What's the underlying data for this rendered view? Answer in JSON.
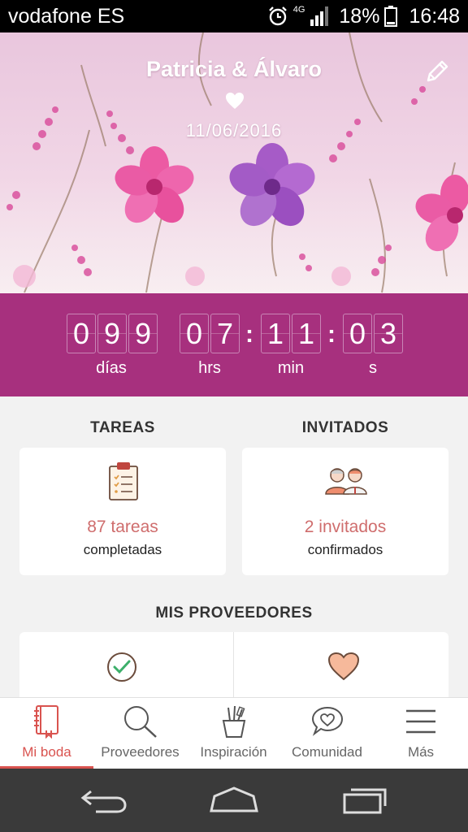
{
  "status_bar": {
    "carrier": "vodafone ES",
    "network": "4G",
    "battery": "18%",
    "time": "16:48"
  },
  "header": {
    "couple_names": "Patricia & Álvaro",
    "date": "11/06/2016"
  },
  "countdown": {
    "days": [
      "0",
      "9",
      "9"
    ],
    "hours": [
      "0",
      "7"
    ],
    "minutes": [
      "1",
      "1"
    ],
    "seconds": [
      "0",
      "3"
    ],
    "labels": {
      "days": "días",
      "hours": "hrs",
      "minutes": "min",
      "seconds": "s"
    }
  },
  "tasks": {
    "title": "TAREAS",
    "count": "87 tareas",
    "sub": "completadas"
  },
  "guests": {
    "title": "INVITADOS",
    "count": "2 invitados",
    "sub": "confirmados"
  },
  "providers": {
    "title": "MIS PROVEEDORES",
    "left_icon": "check-circle-icon",
    "right_icon": "heart-icon"
  },
  "nav": {
    "items": [
      {
        "label": "Mi boda",
        "icon": "notebook-icon",
        "active": true
      },
      {
        "label": "Proveedores",
        "icon": "search-icon",
        "active": false
      },
      {
        "label": "Inspiración",
        "icon": "pencil-cup-icon",
        "active": false
      },
      {
        "label": "Comunidad",
        "icon": "heart-bubble-icon",
        "active": false
      },
      {
        "label": "Más",
        "icon": "menu-icon",
        "active": false
      }
    ]
  },
  "colors": {
    "accent": "#a7307e",
    "highlight": "#cf6d6d",
    "active_nav": "#d9534f"
  }
}
